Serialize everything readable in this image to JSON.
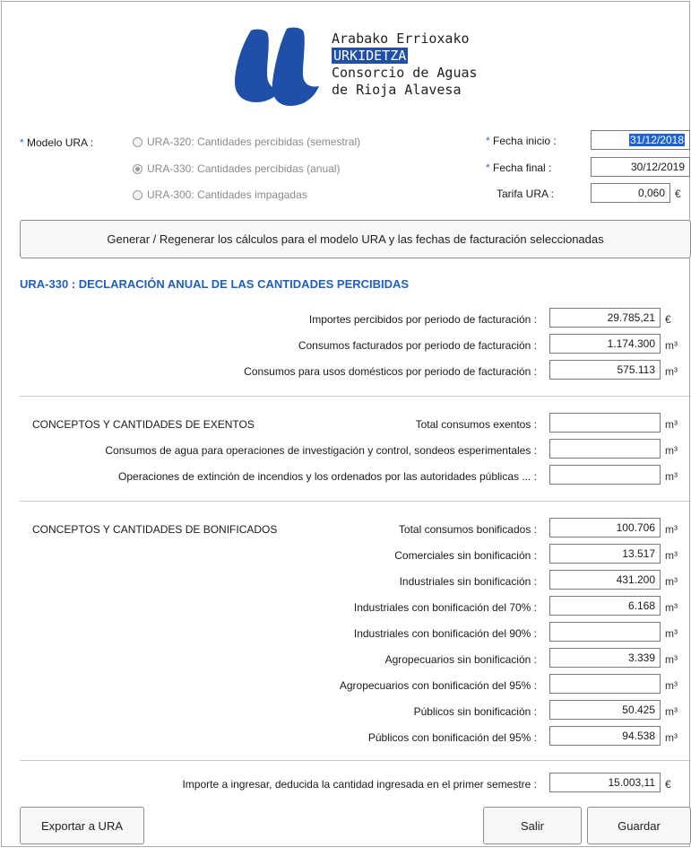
{
  "logo": {
    "line1": "Arabako Errioxako",
    "line2": "URKIDETZA",
    "line3": "Consorcio de Aguas",
    "line4": "de Rioja Alavesa"
  },
  "colors": {
    "accent": "#1f5fbf",
    "selection": "#1e63d6",
    "logo_blue": "#1f4fa8"
  },
  "modelo": {
    "label": "Modelo URA :",
    "options": [
      {
        "label": "URA-320: Cantidades percibidas (semestral)",
        "selected": false
      },
      {
        "label": "URA-330: Cantidades percibidas (anual)",
        "selected": true
      },
      {
        "label": "URA-300: Cantidades impagadas",
        "selected": false
      }
    ]
  },
  "fechas": {
    "inicio_label": "Fecha inicio :",
    "inicio_value": "31/12/2018",
    "final_label": "Fecha final :",
    "final_value": "30/12/2019",
    "tarifa_label": "Tarifa URA :",
    "tarifa_value": "0,060",
    "tarifa_unit": "€"
  },
  "generar_button": "Generar / Regenerar los cálculos para el modelo URA y las fechas de facturación seleccionadas",
  "section_title": "URA-330 : DECLARACIÓN ANUAL DE LAS CANTIDADES PERCIBIDAS",
  "periodo": [
    {
      "label": "Importes percibidos por periodo de facturación :",
      "value": "29.785,21",
      "unit": "€"
    },
    {
      "label": "Consumos facturados por periodo de facturación :",
      "value": "1.174.300",
      "unit": "m³"
    },
    {
      "label": "Consumos para usos domésticos por periodo de facturación :",
      "value": "575.113",
      "unit": "m³"
    }
  ],
  "exentos": {
    "heading": "CONCEPTOS Y CANTIDADES DE EXENTOS",
    "rows": [
      {
        "label": "Total consumos exentos :",
        "value": "",
        "unit": "m³"
      },
      {
        "label": "Consumos de agua para operaciones de investigación y control, sondeos esperimentales :",
        "value": "",
        "unit": "m³"
      },
      {
        "label": "Operaciones de extinción de incendios y los ordenados por las autoridades públicas ... :",
        "value": "",
        "unit": "m³"
      }
    ]
  },
  "bonificados": {
    "heading": "CONCEPTOS Y CANTIDADES DE BONIFICADOS",
    "rows": [
      {
        "label": "Total consumos bonificados :",
        "value": "100.706",
        "unit": "m³"
      },
      {
        "label": "Comerciales sin bonificación :",
        "value": "13.517",
        "unit": "m³"
      },
      {
        "label": "Industriales sin bonificación :",
        "value": "431.200",
        "unit": "m³"
      },
      {
        "label": "Industriales con bonificación del 70% :",
        "value": "6.168",
        "unit": "m³"
      },
      {
        "label": "Industriales con bonificación del 90% :",
        "value": "",
        "unit": "m³"
      },
      {
        "label": "Agropecuarios sin bonificación :",
        "value": "3.339",
        "unit": "m³"
      },
      {
        "label": "Agropecuarios con bonificación del 95% :",
        "value": "",
        "unit": "m³"
      },
      {
        "label": "Públicos sin bonificación :",
        "value": "50.425",
        "unit": "m³"
      },
      {
        "label": "Públicos con bonificación del 95% :",
        "value": "94.538",
        "unit": "m³"
      }
    ]
  },
  "importe": {
    "label": "Importe a ingresar, deducida la cantidad ingresada en el primer semestre :",
    "value": "15.003,11",
    "unit": "€"
  },
  "buttons": {
    "exportar": "Exportar a URA",
    "salir": "Salir",
    "guardar": "Guardar"
  }
}
